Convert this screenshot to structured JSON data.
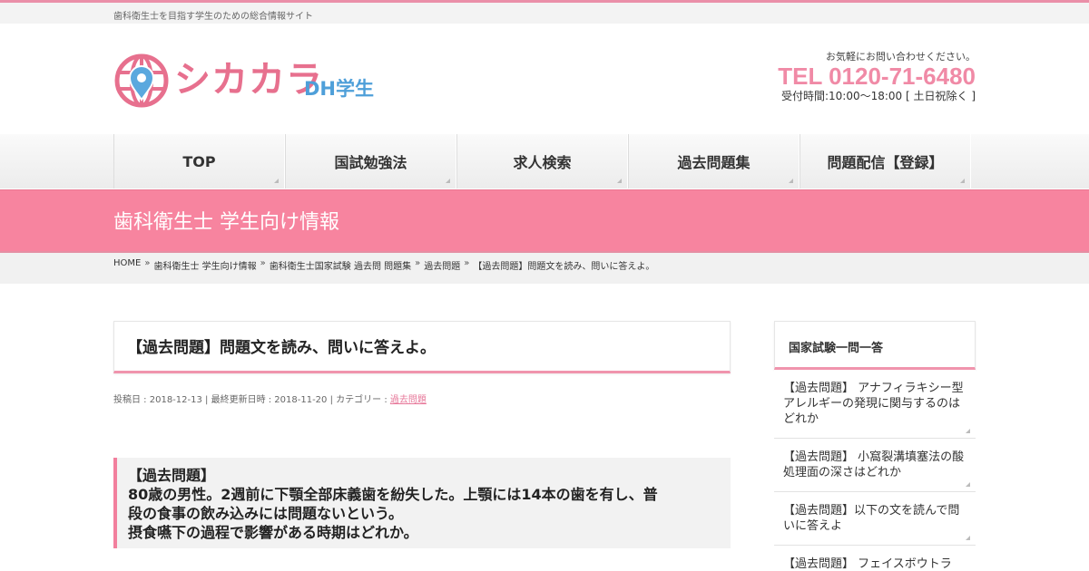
{
  "site": {
    "tagline": "歯科衛生士を目指す学生のための総合情報サイト",
    "logo_main": "シカカラ",
    "logo_sub": "DH学生",
    "brand_pink": "#e7708e",
    "brand_blue": "#4e9fd9"
  },
  "contact": {
    "note": "お気軽にお問い合わせください。",
    "tel": "TEL 0120-71-6480",
    "hours": "受付時間:10:00～18:00 [ 土日祝除く ]"
  },
  "nav": {
    "items": [
      {
        "label": "TOP"
      },
      {
        "label": "国試勉強法"
      },
      {
        "label": "求人検索"
      },
      {
        "label": "過去問題集"
      },
      {
        "label": "問題配信【登録】"
      }
    ]
  },
  "banner": {
    "title": "歯科衛生士 学生向け情報",
    "color": "#f7849f"
  },
  "breadcrumb": {
    "items": [
      {
        "label": "HOME"
      },
      {
        "label": "歯科衛生士 学生向け情報"
      },
      {
        "label": "歯科衛生士国家試験 過去問 問題集"
      },
      {
        "label": "過去問題"
      },
      {
        "label": "【過去問題】問題文を読み、問いに答えよ。"
      }
    ],
    "separator": "»"
  },
  "article": {
    "title": "【過去問題】問題文を読み、問いに答えよ。",
    "meta_prefix": "投稿日 : 2018-12-13 | 最終更新日時 : 2018-11-20 | カテゴリー : ",
    "category": "過去問題",
    "question": {
      "line1": "【過去問題】",
      "line2": "80歳の男性。2週前に下顎全部床義歯を紛失した。上顎には14本の歯を有し、普",
      "line3": "段の食事の飲み込みには問題ないという。",
      "line4": "摂食嚥下の過程で影響がある時期はどれか。"
    }
  },
  "sidebar": {
    "heading": "国家試験一問一答",
    "items": [
      {
        "label": "【過去問題】 アナフィラキシー型アレルギーの発現に関与するのはどれか"
      },
      {
        "label": "【過去問題】 小窩裂溝填塞法の酸処理面の深さはどれか"
      },
      {
        "label": "【過去問題】以下の文を読んで問いに答えよ"
      },
      {
        "label": "【過去問題】 フェイスボウトラ"
      }
    ]
  }
}
